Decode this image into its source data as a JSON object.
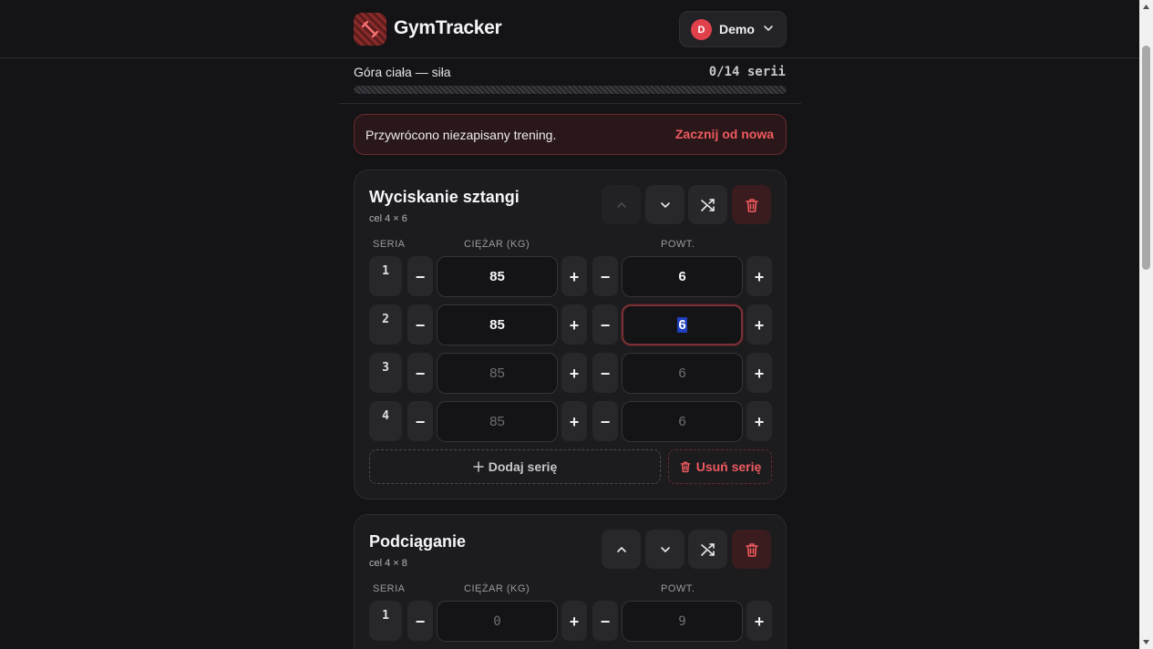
{
  "app": {
    "brand": "GymTracker",
    "logo_icon": "dumbbell-icon",
    "accent": "#e0414a"
  },
  "user": {
    "initial": "D",
    "name": "Demo"
  },
  "workout": {
    "title": "Góra ciała — siła",
    "progress_text": "0/14 serii",
    "progress_fraction": 0
  },
  "banner": {
    "text": "Przywrócono niezapisany trening.",
    "action": "Zacznij od nowa"
  },
  "columns": {
    "set": "SERIA",
    "weight": "CIĘŻAR (KG)",
    "reps": "POWT."
  },
  "controls": {
    "minus": "−",
    "plus": "+",
    "add_set": "Dodaj serię",
    "remove_set": "Usuń serię"
  },
  "exercises": [
    {
      "name": "Wyciskanie sztangi",
      "target": "cel 4 × 6",
      "sets": [
        {
          "no": "1",
          "weight": "85",
          "reps": "6"
        },
        {
          "no": "2",
          "weight": "85",
          "reps": "6"
        },
        {
          "no": "3",
          "weight": "85",
          "reps": "6"
        },
        {
          "no": "4",
          "weight": "85",
          "reps": "6"
        }
      ]
    },
    {
      "name": "Podciąganie",
      "target": "cel 4 × 8",
      "sets": [
        {
          "no": "1",
          "weight": "0",
          "reps": "9"
        }
      ]
    }
  ]
}
